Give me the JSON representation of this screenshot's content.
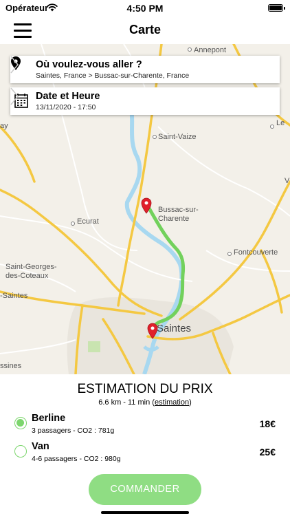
{
  "status_bar": {
    "carrier": "Opérateur",
    "time": "4:50 PM"
  },
  "nav": {
    "title": "Carte"
  },
  "destination_card": {
    "title": "Où voulez-vous aller ?",
    "route": "Saintes, France > Bussac-sur-Charente, France",
    "icon": "location-pin-icon"
  },
  "datetime_card": {
    "title": "Date et Heure",
    "value": "13/11/2020 - 17:50",
    "icon": "calendar-icon"
  },
  "map": {
    "places": {
      "annepont": "Annepont",
      "saint_vaize": "Saint-Vaize",
      "bussac_1": "Bussac-sur-",
      "bussac_2": "Charente",
      "ecurat": "Ecurat",
      "fontcouverte": "Fontcouverte",
      "saint_georges_1": "Saint-Georges-",
      "saint_georges_2": "des-Coteaux",
      "saintes_left": "-Saintes",
      "saintes": "Saintes",
      "ssines": "ssines",
      "ay": "ay",
      "le": "Le",
      "v": "V"
    },
    "route_color": "#72d15c",
    "marker_color": "#e0202b"
  },
  "estimation": {
    "title": "ESTIMATION DU PRIX",
    "summary": "6.6 km - 11 min",
    "link": "estimation"
  },
  "options": [
    {
      "name": "Berline",
      "detail": "3 passagers - CO2 : 781g",
      "price": "18€",
      "selected": true
    },
    {
      "name": "Van",
      "detail": "4-6 passagers - CO2 : 980g",
      "price": "25€",
      "selected": false
    }
  ],
  "cta": {
    "label": "COMMANDER"
  },
  "colors": {
    "accent": "#7cd66d",
    "button": "#8fdd83"
  }
}
